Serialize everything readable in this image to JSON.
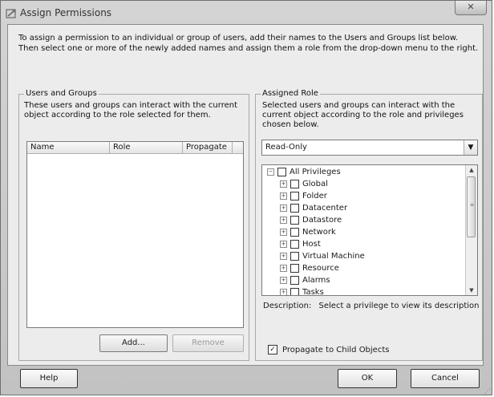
{
  "window": {
    "title": "Assign Permissions",
    "close_glyph": "✕"
  },
  "instructions": "To assign a permission to an individual or group of users, add their names to the Users and Groups list below. Then select one or more of the newly added names and assign them a role from the drop-down menu to the right.",
  "users_groups": {
    "legend": "Users and Groups",
    "description": "These users and groups can interact with the current object according to the role selected for them.",
    "columns": [
      "Name",
      "Role",
      "Propagate"
    ],
    "add_label": "Add...",
    "remove_label": "Remove"
  },
  "assigned_role": {
    "legend": "Assigned Role",
    "description": "Selected users and groups can interact with the current object according to the role and privileges chosen below.",
    "role_selected": "Read-Only",
    "privileges_root": "All Privileges",
    "privileges": [
      "Global",
      "Folder",
      "Datacenter",
      "Datastore",
      "Network",
      "Host",
      "Virtual Machine",
      "Resource",
      "Alarms",
      "Tasks"
    ],
    "description_label": "Description:",
    "description_value": "Select a privilege to view its description",
    "propagate_label": "Propagate to Child Objects",
    "propagate_checked": true
  },
  "buttons": {
    "help": "Help",
    "ok": "OK",
    "cancel": "Cancel"
  },
  "icons": {
    "window_icon": "permissions-icon",
    "expand": "⊞",
    "collapse": "⊟",
    "scroll_up": "▲",
    "scroll_down": "▼",
    "dropdown": "▼",
    "check": "✓"
  }
}
